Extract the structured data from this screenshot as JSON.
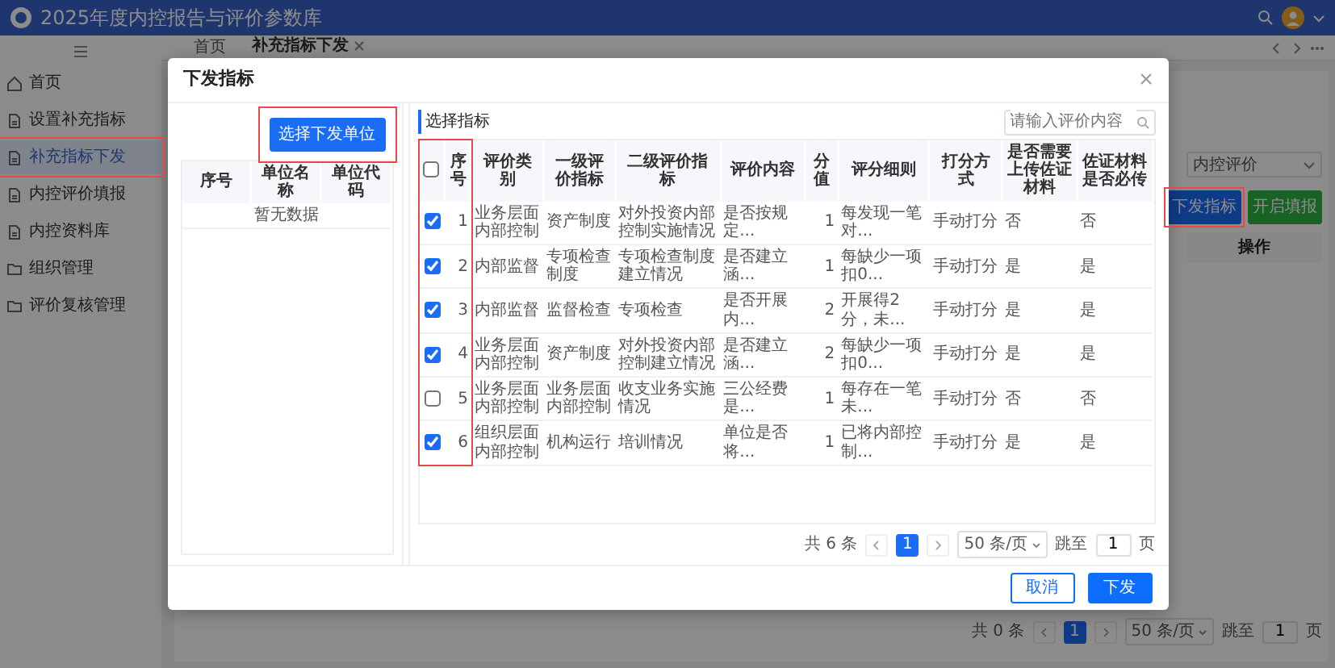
{
  "app": {
    "title": "2025年度内控报告与评价参数库",
    "sidebar": [
      {
        "label": "首页",
        "selected": false,
        "highlighted": false
      },
      {
        "label": "设置补充指标",
        "selected": false,
        "highlighted": false
      },
      {
        "label": "补充指标下发",
        "selected": true,
        "highlighted": true
      },
      {
        "label": "内控评价填报",
        "selected": false,
        "highlighted": false
      },
      {
        "label": "内控资料库",
        "selected": false,
        "highlighted": false
      },
      {
        "label": "组织管理",
        "selected": false,
        "highlighted": false
      },
      {
        "label": "评价复核管理",
        "selected": false,
        "highlighted": false
      }
    ],
    "tabs": [
      {
        "label": "首页",
        "selected": false,
        "closable": false
      },
      {
        "label": "补充指标下发",
        "selected": true,
        "closable": true
      }
    ],
    "filter_select": "内控评价",
    "buttons": [
      {
        "label": "下发指标",
        "kind": "primary",
        "highlighted": true
      },
      {
        "label": "开启填报",
        "kind": "success",
        "highlighted": false
      }
    ],
    "table_header": "操作",
    "pagination": {
      "total": "共 0 条",
      "page": "1",
      "page_size": "50 条/页",
      "jump_label": "跳至",
      "jump_value": "1",
      "page_unit": "页"
    }
  },
  "dialog": {
    "title": "下发指标",
    "left": {
      "button": {
        "label": "选择下发单位",
        "highlighted": true
      },
      "columns": [
        "序号",
        "单位名称",
        "单位代码"
      ],
      "empty_text": "暂无数据"
    },
    "right": {
      "heading": "选择指标",
      "search": {
        "placeholder": "请输入评价内容"
      },
      "header_checked": false,
      "highlight_selection_column": true,
      "columns": [
        "序号",
        "评价类别",
        "一级评价指标",
        "二级评价指标",
        "评价内容",
        "分值",
        "评分细则",
        "打分方式",
        "是否需要上传佐证材料",
        "佐证材料是否必传"
      ],
      "rows": [
        {
          "checked": true,
          "cells": [
            "1",
            "业务层面内部控制",
            "资产制度",
            "对外投资内部控制实施情况",
            "是否按规定...",
            "1",
            "每发现一笔对...",
            "手动打分",
            "否",
            "否"
          ]
        },
        {
          "checked": true,
          "cells": [
            "2",
            "内部监督",
            "专项检查制度",
            "专项检查制度建立情况",
            "是否建立涵...",
            "1",
            "每缺少一项扣0...",
            "手动打分",
            "是",
            "是"
          ]
        },
        {
          "checked": true,
          "cells": [
            "3",
            "内部监督",
            "监督检查",
            "专项检查",
            "是否开展内...",
            "2",
            "开展得2分，未...",
            "手动打分",
            "是",
            "是"
          ]
        },
        {
          "checked": true,
          "cells": [
            "4",
            "业务层面内部控制",
            "资产制度",
            "对外投资内部控制建立情况",
            "是否建立涵...",
            "2",
            "每缺少一项扣0...",
            "手动打分",
            "是",
            "是"
          ]
        },
        {
          "checked": false,
          "cells": [
            "5",
            "业务层面内部控制",
            "业务层面内部控制",
            "收支业务实施情况",
            "三公经费是...",
            "1",
            "每存在一笔未...",
            "手动打分",
            "否",
            "否"
          ]
        },
        {
          "checked": true,
          "cells": [
            "6",
            "组织层面内部控制",
            "机构运行",
            "培训情况",
            "单位是否将...",
            "1",
            "已将内部控制...",
            "手动打分",
            "是",
            "是"
          ]
        }
      ],
      "pagination": {
        "total": "共 6 条",
        "page": "1",
        "page_size": "50 条/页",
        "jump_label": "跳至",
        "jump_value": "1",
        "page_unit": "页"
      }
    },
    "footer_buttons": [
      {
        "label": "取消",
        "kind": "secondary"
      },
      {
        "label": "下发",
        "kind": "primary"
      }
    ]
  }
}
